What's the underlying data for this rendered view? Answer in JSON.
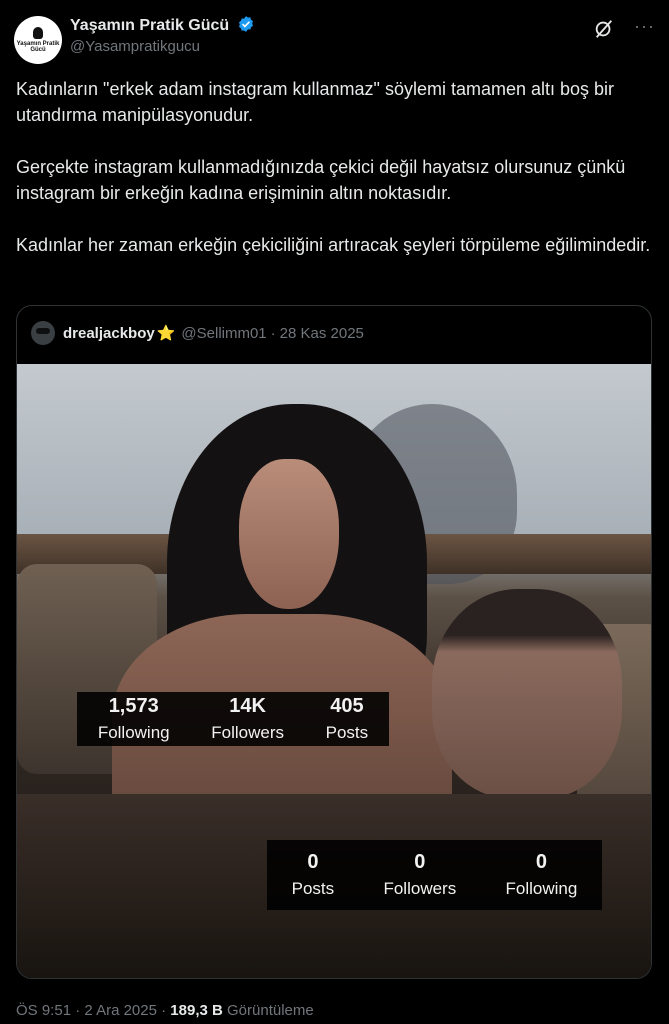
{
  "author": {
    "avatar_text": "Yaşamın Pratik Gücü",
    "name": "Yaşamın Pratik Gücü",
    "handle": "@Yasampratikgucu",
    "verified": true
  },
  "actions": {
    "grok_icon": "grok-icon",
    "more_label": "···"
  },
  "tweet": {
    "paragraphs": [
      "Kadınların \"erkek adam instagram kullanmaz\" söylemi tamamen altı boş bir utandırma manipülasyonudur.",
      "Gerçekte instagram kullanmadığınızda çekici değil hayatsız olursunuz çünkü instagram bir erkeğin kadına erişiminin altın noktasıdır.",
      "Kadınlar her zaman erkeğin çekiciliğini artıracak şeyleri törpüleme eğilimindedir."
    ]
  },
  "quote": {
    "name": "drealjackboy",
    "star": "⭐",
    "handle": "@Sellimm01",
    "separator": "·",
    "date": "28 Kas 2025",
    "stats_top": [
      {
        "num": "1,573",
        "label": "Following"
      },
      {
        "num": "14K",
        "label": "Followers"
      },
      {
        "num": "405",
        "label": "Posts"
      }
    ],
    "stats_bottom": [
      {
        "num": "0",
        "label": "Posts"
      },
      {
        "num": "0",
        "label": "Followers"
      },
      {
        "num": "0",
        "label": "Following"
      }
    ]
  },
  "meta": {
    "time": "ÖS 9:51",
    "sep1": "·",
    "date": "2 Ara 2025",
    "sep2": "·",
    "views_count": "189,3 B",
    "views_label": "Görüntüleme"
  },
  "colors": {
    "background": "#000000",
    "text": "#e7e9ea",
    "secondary": "#71767b",
    "verified": "#1d9bf0",
    "border": "#2f3336"
  }
}
